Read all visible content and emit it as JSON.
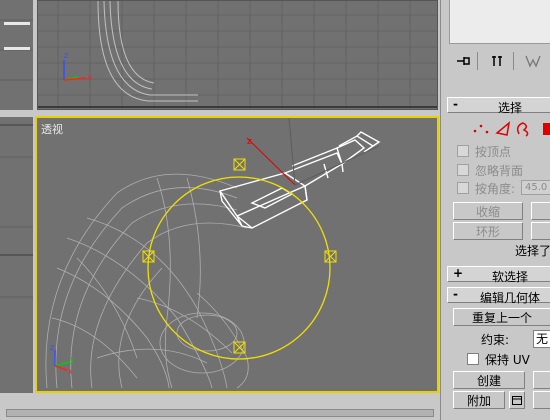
{
  "viewports": {
    "perspective_label": "透视"
  },
  "command_panel": {
    "rollout_selection": {
      "sign": "-",
      "title": "选择"
    },
    "selection_checks": [
      {
        "label": "按顶点"
      },
      {
        "label": "忽略背面"
      },
      {
        "label": "按角度:"
      }
    ],
    "angle_value": "45.0",
    "shrink_button": "收缩",
    "ring_button": "环形",
    "selected_text": "选择了",
    "rollout_soft": {
      "sign": "+",
      "title": "软选择"
    },
    "rollout_edit": {
      "sign": "-",
      "title": "编辑几何体"
    },
    "repeat_last_button": "重复上一个",
    "constraint_label": "约束:",
    "constraint_value": "无",
    "preserve_uv_label": "保持 UV",
    "create_button": "创建",
    "attach_button": "附加"
  },
  "colors": {
    "viewport_bg": "#717171",
    "active_border": "#e6d200",
    "gizmo_yellow": "#f0e000",
    "selection_red": "#e00000"
  }
}
